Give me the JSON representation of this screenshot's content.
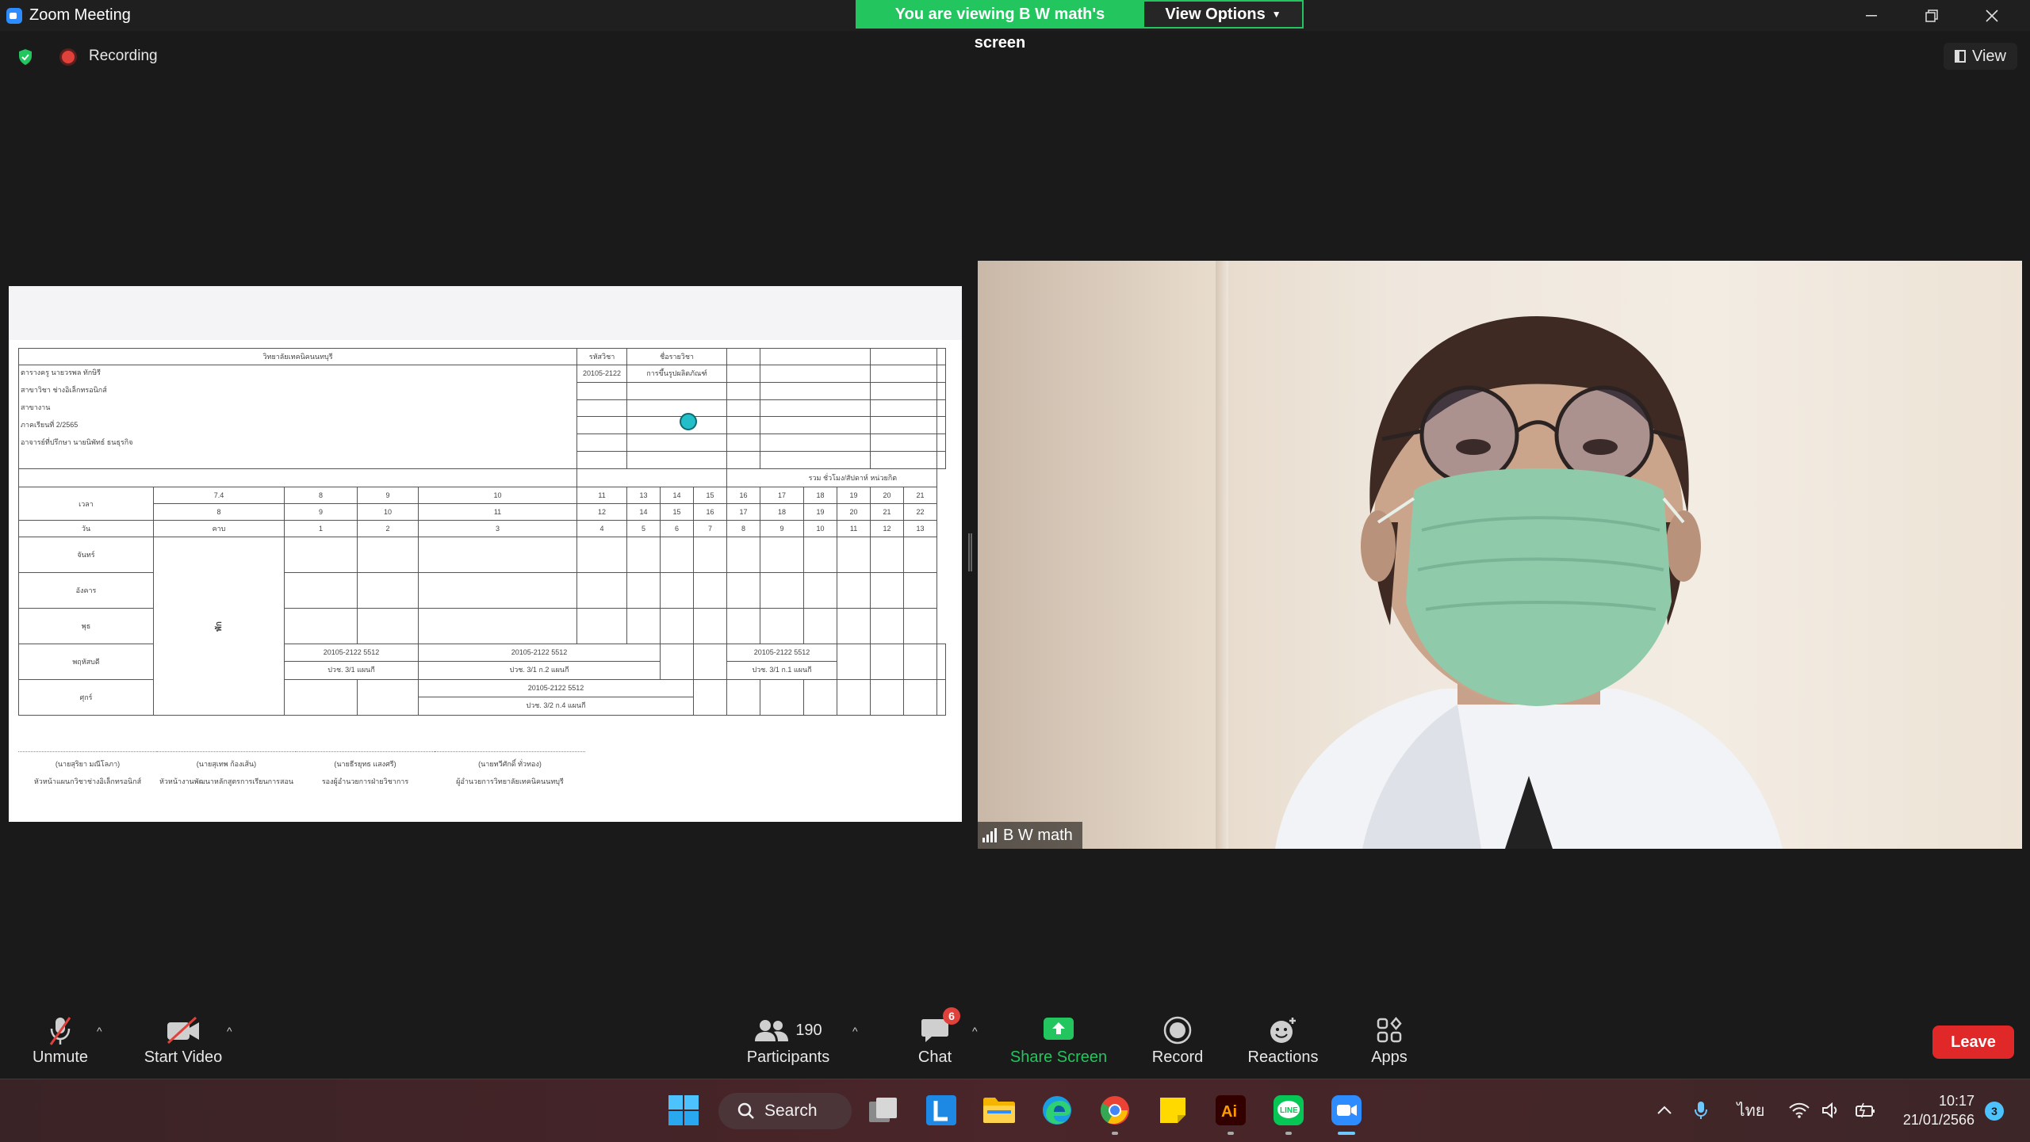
{
  "window": {
    "title": "Zoom Meeting",
    "share_banner": "You are viewing B W math's screen",
    "view_options": "View Options"
  },
  "meeting": {
    "recording_label": "Recording",
    "view_label": "View"
  },
  "video": {
    "participant_name": "B W math"
  },
  "toolbar": {
    "unmute": "Unmute",
    "start_video": "Start Video",
    "participants": "Participants",
    "participants_count": "190",
    "chat": "Chat",
    "chat_badge": "6",
    "share_screen": "Share Screen",
    "record": "Record",
    "reactions": "Reactions",
    "apps": "Apps",
    "leave": "Leave"
  },
  "taskbar": {
    "search_label": "Search",
    "language": "ไทย",
    "time": "10:17",
    "date": "21/01/2566",
    "notification_count": "3",
    "apps": [
      "start-icon",
      "task-view-icon",
      "l-app-icon",
      "file-explorer-icon",
      "edge-icon",
      "chrome-icon",
      "sticky-notes-icon",
      "illustrator-icon",
      "line-icon",
      "zoom-icon"
    ]
  },
  "colors": {
    "share_green": "#22c55e",
    "leave_red": "#e02828",
    "recording_red": "#e0423b"
  },
  "document": {
    "header_cells": [
      "วิทยาลัยเทคนิคนนทบุรี",
      "รหัสวิชา",
      "ชื่อรายวิชา"
    ],
    "course_code": "20105-2122",
    "course_name": "การขึ้นรูปผลิตภัณฑ์",
    "info_lines": [
      "ตารางครู นายวรพล ทักษิรี",
      "สาขาวิชา ช่างอิเล็กทรอนิกส์",
      "สาขางาน",
      "ภาคเรียนที่ 2/2565",
      "อาจารย์ที่ปรึกษา นายนิพัทธ์ ธนธุรกิจ"
    ],
    "total_label": "รวม ชั่วโมง/สัปดาห์ หน่วยกิต",
    "row_labels": [
      "เวลา",
      "วัน",
      "จันทร์",
      "อังคาร",
      "พุธ",
      "พฤหัสบดี",
      "ศุกร์"
    ],
    "time_row1": [
      "7.4",
      "8",
      "9",
      "10",
      "11",
      "13",
      "14",
      "15",
      "16",
      "17",
      "18",
      "19",
      "20",
      "21"
    ],
    "time_row2": [
      "8",
      "9",
      "10",
      "11",
      "12",
      "14",
      "15",
      "16",
      "17",
      "18",
      "19",
      "20",
      "21",
      "22"
    ],
    "period_row": [
      "คาบ",
      "1",
      "2",
      "3",
      "4",
      "5",
      "6",
      "7",
      "8",
      "9",
      "10",
      "11",
      "12",
      "13"
    ],
    "break_label": "พัก",
    "thu_entries": [
      "20105-2122 5512",
      "20105-2122 5512",
      "20105-2122 5512"
    ],
    "thu_groups": [
      "ปวช. 3/1 แผนกี",
      "ปวช. 3/1 ก.2 แผนกี",
      "ปวช. 3/1 ก.1 แผนกี"
    ],
    "fri_entry": "20105-2122 5512",
    "fri_group": "ปวช. 3/2 ก.4 แผนกี",
    "signatures": [
      {
        "name": "(นายสุริยา มณีโลภา)",
        "role": "หัวหน้าแผนกวิชาช่างอิเล็กทรอนิกส์"
      },
      {
        "name": "(นายสุเทพ ก้องเส้น)",
        "role": "หัวหน้างานพัฒนาหลักสูตรการเรียนการสอน"
      },
      {
        "name": "(นายธีรยุทธ แสงศรี)",
        "role": "รองผู้อำนวยการฝ่ายวิชาการ"
      },
      {
        "name": "(นายทวีศักดิ์ ทั่วทอง)",
        "role": "ผู้อำนวยการวิทยาลัยเทคนิคนนทบุรี"
      }
    ]
  }
}
